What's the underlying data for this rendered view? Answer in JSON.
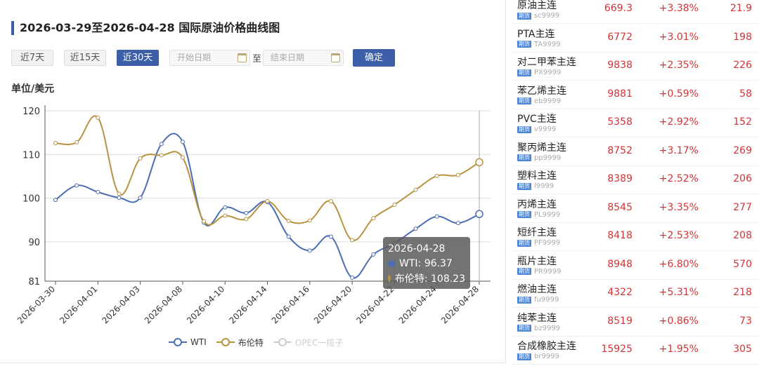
{
  "chart_panel": {
    "title": "2026-03-29至2026-04-28 国际原油价格曲线图",
    "range_buttons": [
      {
        "label": "近7天",
        "active": false
      },
      {
        "label": "近15天",
        "active": false
      },
      {
        "label": "近30天",
        "active": true
      }
    ],
    "start_placeholder": "开始日期",
    "to_label": "至",
    "end_placeholder": "结束日期",
    "confirm_label": "确定",
    "unit_label": "单位/美元"
  },
  "chart_data": {
    "type": "line",
    "categories": [
      "2026-03-30",
      "2026-03-31",
      "2026-04-01",
      "2026-04-02",
      "2026-04-03",
      "2026-04-07",
      "2026-04-08",
      "2026-04-09",
      "2026-04-10",
      "2026-04-13",
      "2026-04-14",
      "2026-04-15",
      "2026-04-16",
      "2026-04-17",
      "2026-04-20",
      "2026-04-21",
      "2026-04-22",
      "2026-04-23",
      "2026-04-24",
      "2026-04-27",
      "2026-04-28"
    ],
    "tick_labels": [
      "2026-03-30",
      "2026-04-01",
      "2026-04-03",
      "2026-04-08",
      "2026-04-10",
      "2026-04-14",
      "2026-04-16",
      "2026-04-20",
      "2026-04-22",
      "2026-04-24",
      "2026-04-28"
    ],
    "series": [
      {
        "name": "WTI",
        "color": "#4a6db3",
        "values": [
          99.6,
          102.9,
          101.4,
          100.1,
          100.1,
          112.4,
          112.9,
          94.4,
          97.9,
          96.6,
          99.1,
          91.2,
          88.0,
          91.2,
          81.8,
          87.1,
          89.7,
          93.0,
          95.8,
          94.3,
          96.37
        ]
      },
      {
        "name": "布伦特",
        "color": "#b8923f",
        "values": [
          112.6,
          112.8,
          118.4,
          101.0,
          109.1,
          109.8,
          109.3,
          94.7,
          96.0,
          95.2,
          99.3,
          94.8,
          94.9,
          99.3,
          90.4,
          95.4,
          98.5,
          101.9,
          105.1,
          105.3,
          108.23
        ]
      },
      {
        "name": "OPEC一揽子",
        "color": "#cccccc",
        "disabled": true,
        "values": []
      }
    ],
    "ylim": [
      81,
      120
    ],
    "yticks": [
      81,
      90,
      100,
      110,
      120
    ],
    "grid": true,
    "legend": "bottom-center",
    "tooltip": {
      "date": "2026-04-28",
      "rows": [
        {
          "label": "WTI: 96.37"
        },
        {
          "label": "布伦特: 108.23"
        }
      ]
    }
  },
  "quotes": [
    {
      "name": "原油主连",
      "code": "sc9999",
      "price": "669.3",
      "change": "+3.38%",
      "value": "21.9"
    },
    {
      "name": "PTA主连",
      "code": "TA9999",
      "price": "6772",
      "change": "+3.01%",
      "value": "198"
    },
    {
      "name": "对二甲苯主连",
      "code": "PX9999",
      "price": "9838",
      "change": "+2.35%",
      "value": "226"
    },
    {
      "name": "苯乙烯主连",
      "code": "eb9999",
      "price": "9881",
      "change": "+0.59%",
      "value": "58"
    },
    {
      "name": "PVC主连",
      "code": "v9999",
      "price": "5358",
      "change": "+2.92%",
      "value": "152"
    },
    {
      "name": "聚丙烯主连",
      "code": "pp9999",
      "price": "8752",
      "change": "+3.17%",
      "value": "269"
    },
    {
      "name": "塑料主连",
      "code": "l9999",
      "price": "8389",
      "change": "+2.52%",
      "value": "206"
    },
    {
      "name": "丙烯主连",
      "code": "PL9999",
      "price": "8545",
      "change": "+3.35%",
      "value": "277"
    },
    {
      "name": "短纤主连",
      "code": "PF9999",
      "price": "8418",
      "change": "+2.53%",
      "value": "208"
    },
    {
      "name": "瓶片主连",
      "code": "PR9999",
      "price": "8948",
      "change": "+6.80%",
      "value": "570"
    },
    {
      "name": "燃油主连",
      "code": "fu9999",
      "price": "4322",
      "change": "+5.31%",
      "value": "218"
    },
    {
      "name": "纯苯主连",
      "code": "bz9999",
      "price": "8519",
      "change": "+0.86%",
      "value": "73"
    },
    {
      "name": "合成橡胶主连",
      "code": "br9999",
      "price": "15925",
      "change": "+1.95%",
      "value": "305"
    }
  ],
  "quote_tag": "期货",
  "colors": {
    "accent": "#3c5fa8",
    "up": "#d23434"
  }
}
